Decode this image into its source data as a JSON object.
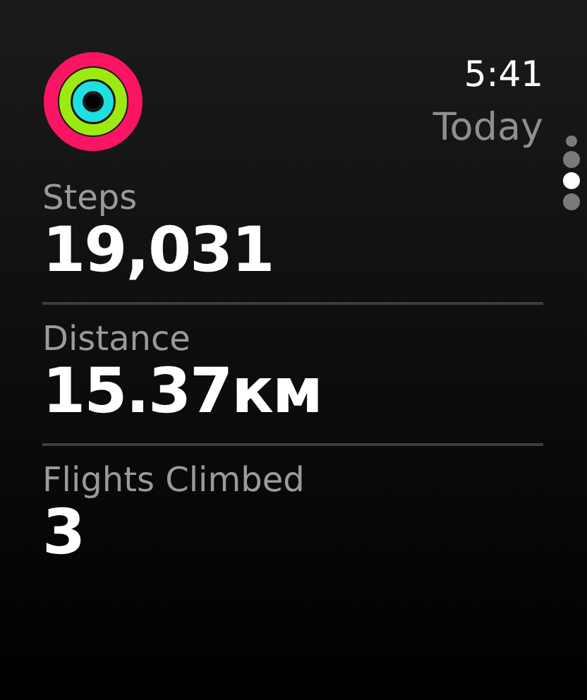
{
  "header": {
    "time": "5:41",
    "date_label": "Today"
  },
  "page_dots": [
    {
      "selected": false
    },
    {
      "selected": false
    },
    {
      "selected": true
    },
    {
      "selected": false
    }
  ],
  "metrics": [
    {
      "label": "Steps",
      "value": "19,031"
    },
    {
      "label": "Distance",
      "value": "15.37км"
    },
    {
      "label": "Flights Climbed",
      "value": "3"
    }
  ]
}
